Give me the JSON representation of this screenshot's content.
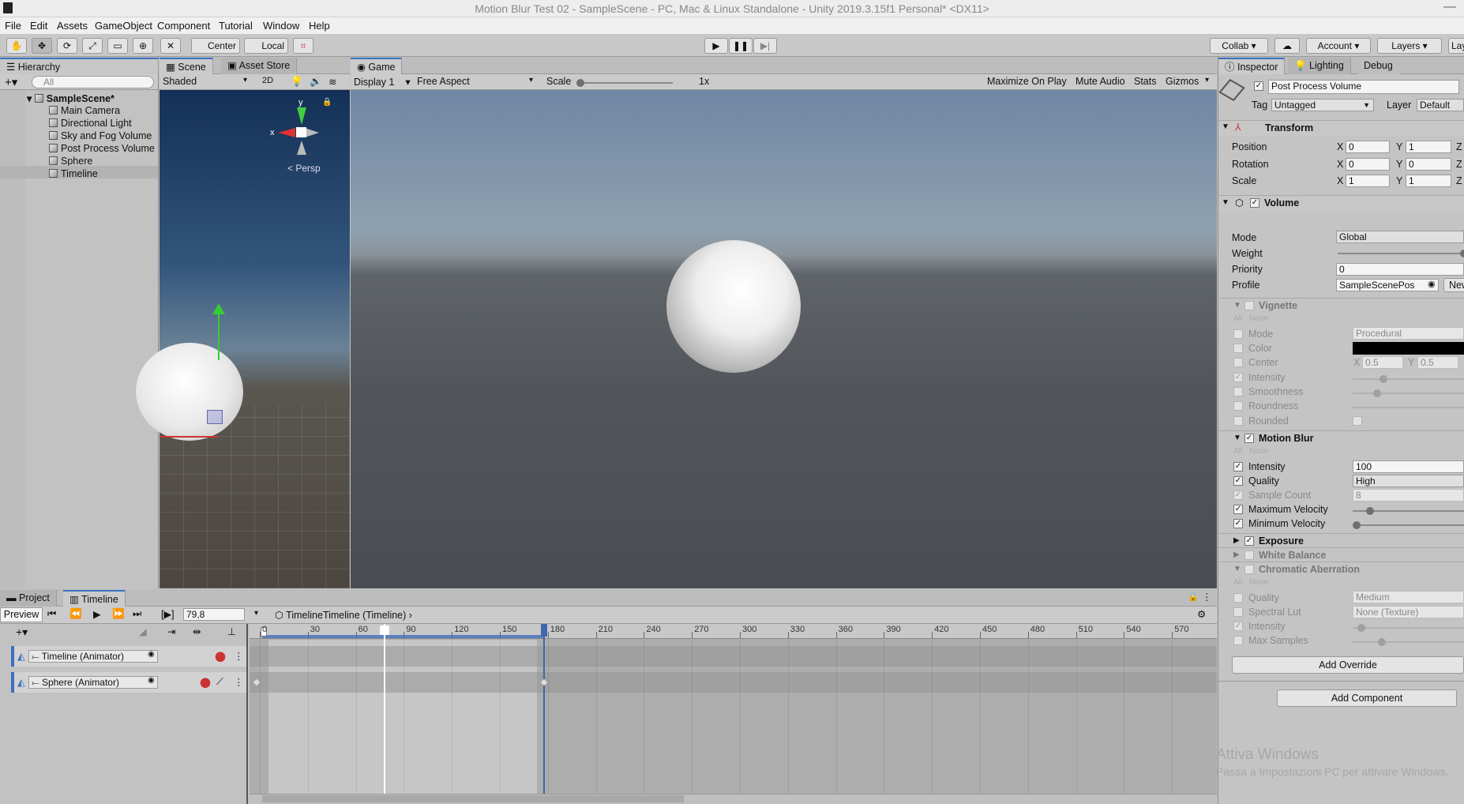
{
  "title": "Motion Blur Test 02 - SampleScene - PC, Mac & Linux Standalone - Unity 2019.3.15f1 Personal* <DX11>",
  "menu": [
    "File",
    "Edit",
    "Assets",
    "GameObject",
    "Component",
    "Tutorial",
    "Window",
    "Help"
  ],
  "toolbar": {
    "center": "Center",
    "local": "Local",
    "collab": "Collab",
    "account": "Account",
    "layers": "Layers",
    "layout": "Lay"
  },
  "hierarchy": {
    "tab": "Hierarchy",
    "search_placeholder": "All",
    "scene": "SampleScene*",
    "items": [
      "Main Camera",
      "Directional Light",
      "Sky and Fog Volume",
      "Post Process Volume",
      "Sphere",
      "Timeline"
    ]
  },
  "scene": {
    "tab": "Scene",
    "store_tab": "Asset Store",
    "shading": "Shaded",
    "mode2d": "2D",
    "persp": "Persp",
    "gizmo_y": "y",
    "gizmo_x": "x"
  },
  "game": {
    "tab": "Game",
    "display": "Display 1",
    "aspect": "Free Aspect",
    "scale_label": "Scale",
    "scale_value": "1x",
    "maximize": "Maximize On Play",
    "mute": "Mute Audio",
    "stats": "Stats",
    "gizmos": "Gizmos"
  },
  "inspector": {
    "tabs": [
      "Inspector",
      "Lighting",
      "Debug"
    ],
    "object_name": "Post Process Volume",
    "tag_label": "Tag",
    "tag": "Untagged",
    "layer_label": "Layer",
    "layer": "Default",
    "transform": {
      "title": "Transform",
      "rows": [
        {
          "label": "Position",
          "x": "0",
          "y": "1"
        },
        {
          "label": "Rotation",
          "x": "0",
          "y": "0"
        },
        {
          "label": "Scale",
          "x": "1",
          "y": "1"
        }
      ],
      "x": "X",
      "y": "Y",
      "z": "Z"
    },
    "volume": {
      "title": "Volume",
      "mode_label": "Mode",
      "mode": "Global",
      "weight_label": "Weight",
      "weight": 1,
      "priority_label": "Priority",
      "priority": "0",
      "profile_label": "Profile",
      "profile": "SampleScenePos",
      "new_btn": "New"
    },
    "all": "All",
    "none": "None",
    "vignette": {
      "title": "Vignette",
      "rows": [
        "Mode",
        "Color",
        "Center",
        "Intensity",
        "Smoothness",
        "Roundness",
        "Rounded"
      ],
      "mode": "Procedural",
      "cx": "0.5",
      "cy": "0.5"
    },
    "motion_blur": {
      "title": "Motion Blur",
      "rows": [
        "Intensity",
        "Quality",
        "Sample Count",
        "Maximum Velocity",
        "Minimum Velocity"
      ],
      "intensity": "100",
      "quality": "High",
      "sample_count": "8"
    },
    "exposure": "Exposure",
    "white_balance": "White Balance",
    "chromatic": {
      "title": "Chromatic Aberration",
      "rows": [
        "Quality",
        "Spectral Lut",
        "Intensity",
        "Max Samples"
      ],
      "quality": "Medium",
      "lut": "None (Texture)"
    },
    "add_override": "Add Override",
    "add_component": "Add Component"
  },
  "timeline": {
    "tabs": [
      "Project",
      "Timeline"
    ],
    "preview": "Preview",
    "frame": "79,8",
    "asset": "TimelineTimeline (Timeline)",
    "ticks": [
      "0",
      "30",
      "60",
      "90",
      "120",
      "150",
      "180",
      "210",
      "240",
      "270",
      "300",
      "330",
      "360",
      "390",
      "420",
      "450",
      "480",
      "510",
      "540",
      "570"
    ],
    "tracks": [
      "Timeline (Animator)",
      "Sphere (Animator)"
    ]
  },
  "watermark": {
    "line1": "Attiva Windows",
    "line2": "Passa a Impostazioni PC per attivare Windows."
  }
}
